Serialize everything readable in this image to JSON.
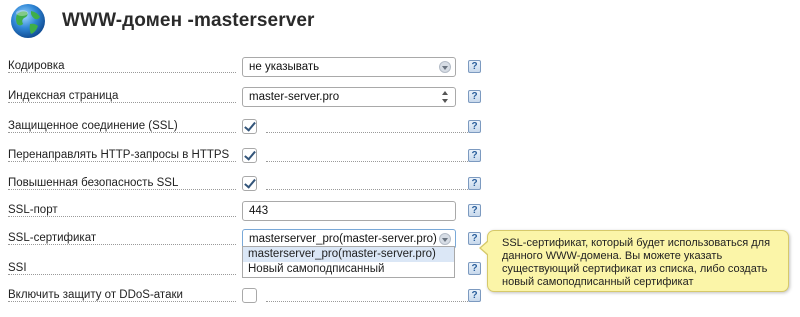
{
  "header": {
    "title": "WWW-домен -masterserver",
    "icon": "globe-icon"
  },
  "form": {
    "encoding": {
      "label": "Кодировка",
      "value": "не указывать"
    },
    "index_page": {
      "label": "Индексная страница",
      "value": "master-server.pro"
    },
    "ssl": {
      "label": "Защищенное соединение (SSL)",
      "checked": true
    },
    "redirect_https": {
      "label": "Перенаправлять HTTP-запросы в HTTPS",
      "checked": true
    },
    "ssl_security": {
      "label": "Повышенная безопасность SSL",
      "checked": true
    },
    "ssl_port": {
      "label": "SSL-порт",
      "value": "443"
    },
    "ssl_cert": {
      "label": "SSL-сертификат",
      "value": "masterserver_pro(master-server.pro)",
      "options": [
        "masterserver_pro(master-server.pro)",
        "Новый самоподписанный"
      ]
    },
    "ssi": {
      "label": "SSI"
    },
    "ddos": {
      "label": "Включить защиту от DDoS-атаки",
      "checked": false
    }
  },
  "help_label": "?",
  "tooltip": {
    "text": "SSL-сертификат, который будет использоваться для данного WWW-домена. Вы можете указать существующий сертификат из списка, либо создать новый самоподписанный сертификат"
  },
  "colors": {
    "tooltip_bg": "#fbf5a8",
    "help_icon": "#2b5f9c",
    "checkmark": "#33557a"
  }
}
